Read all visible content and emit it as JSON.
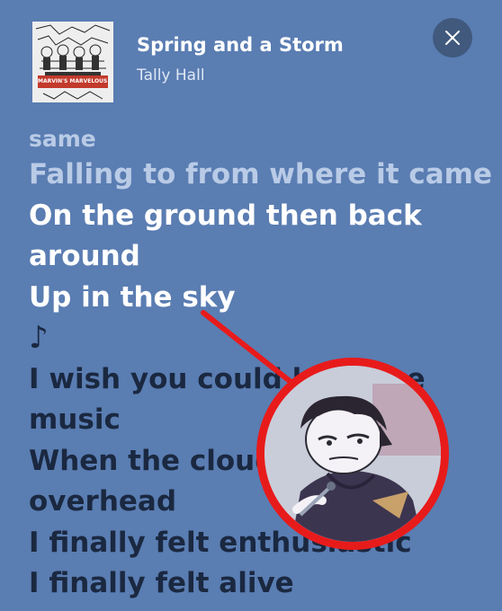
{
  "header": {
    "song_title": "Spring and a Storm",
    "artist": "Tally Hall",
    "close_icon": "close-icon",
    "album_art_label": "MARVIN'S MARVELOUS MECHANICAL MUSEUM"
  },
  "lyrics": {
    "lines": [
      {
        "text": "same",
        "state": "past"
      },
      {
        "text": "Falling to from where it came",
        "state": "past"
      },
      {
        "text": "On the ground then back",
        "state": "current"
      },
      {
        "text": "around",
        "state": "current"
      },
      {
        "text": "Up in the sky",
        "state": "current"
      },
      {
        "text": "♪",
        "state": "note"
      },
      {
        "text": "I wish you could hear the",
        "state": "future"
      },
      {
        "text": "music",
        "state": "future"
      },
      {
        "text": "When the clouds",
        "state": "future"
      },
      {
        "text": "overhead",
        "state": "future"
      },
      {
        "text": "I finally felt enthusiastic",
        "state": "future"
      },
      {
        "text": "I finally felt alive",
        "state": "future"
      }
    ]
  },
  "overlay": {
    "annotation_color": "#e81b1b",
    "image": "cartoon-character-with-microphone"
  },
  "colors": {
    "background": "#5a7db2",
    "current_lyric": "#ffffff",
    "past_lyric": "#b9cbe6",
    "future_lyric": "#1a2840"
  }
}
